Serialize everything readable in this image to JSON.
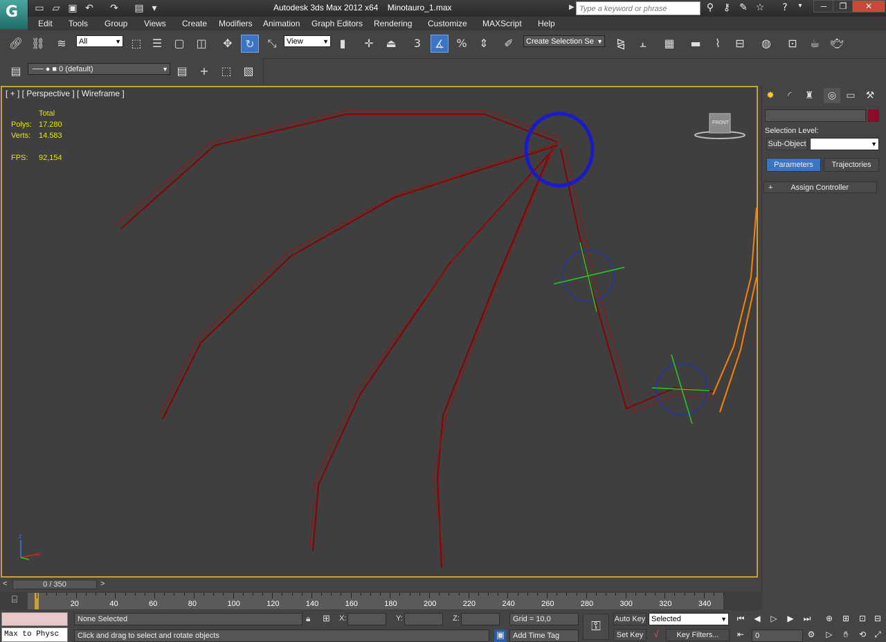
{
  "app": {
    "logo_glyph": "G",
    "title": "Autodesk 3ds Max  2012 x64",
    "file_name": "Minotauro_1.max",
    "search_placeholder": "Type a keyword or phrase"
  },
  "menu": [
    "Edit",
    "Tools",
    "Group",
    "Views",
    "Create",
    "Modifiers",
    "Animation",
    "Graph Editors",
    "Rendering",
    "Customize",
    "MAXScript",
    "Help"
  ],
  "toolbar": {
    "selection_filter": "All",
    "reference_coord": "View",
    "snap_label": "3",
    "named_selection": "Create Selection Se"
  },
  "layer": {
    "current": "0 (default)"
  },
  "viewport": {
    "label": "[ + ] [ Perspective ] [ Wireframe ]",
    "stats_header": "Total",
    "polys_label": "Polys:",
    "polys_value": "17.280",
    "verts_label": "Verts:",
    "verts_value": "14.583",
    "fps_label": "FPS:",
    "fps_value": "92,154",
    "viewcube_label": "FRONT",
    "axis_z": "z",
    "axis_x": "x",
    "object_color": "#8b0000",
    "selected_color": "#ff8000"
  },
  "command_panel": {
    "selection_level_label": "Selection Level:",
    "sub_object_label": "Sub-Object",
    "tab_parameters": "Parameters",
    "tab_trajectories": "Trajectories",
    "rollout_toggle": "+",
    "rollout_title": "Assign Controller",
    "swatch_color": "#8a0b2a"
  },
  "time": {
    "slider_text": "0 / 350",
    "prev": "<",
    "next": ">",
    "ticks": [
      "0",
      "20",
      "40",
      "60",
      "80",
      "100",
      "120",
      "140",
      "160",
      "180",
      "200",
      "220",
      "240",
      "260",
      "280",
      "300",
      "320",
      "340"
    ]
  },
  "status": {
    "script_listener": "Max to Physc",
    "selection_status": "None Selected",
    "prompt": "Click and drag to select and rotate objects",
    "x_label": "X:",
    "y_label": "Y:",
    "z_label": "Z:",
    "grid": "Grid = 10,0",
    "add_time_tag": "Add Time Tag",
    "auto_key": "Auto Key",
    "set_key": "Set Key",
    "key_mode": "Selected",
    "key_filters": "Key Filters...",
    "frame_value": "0"
  }
}
